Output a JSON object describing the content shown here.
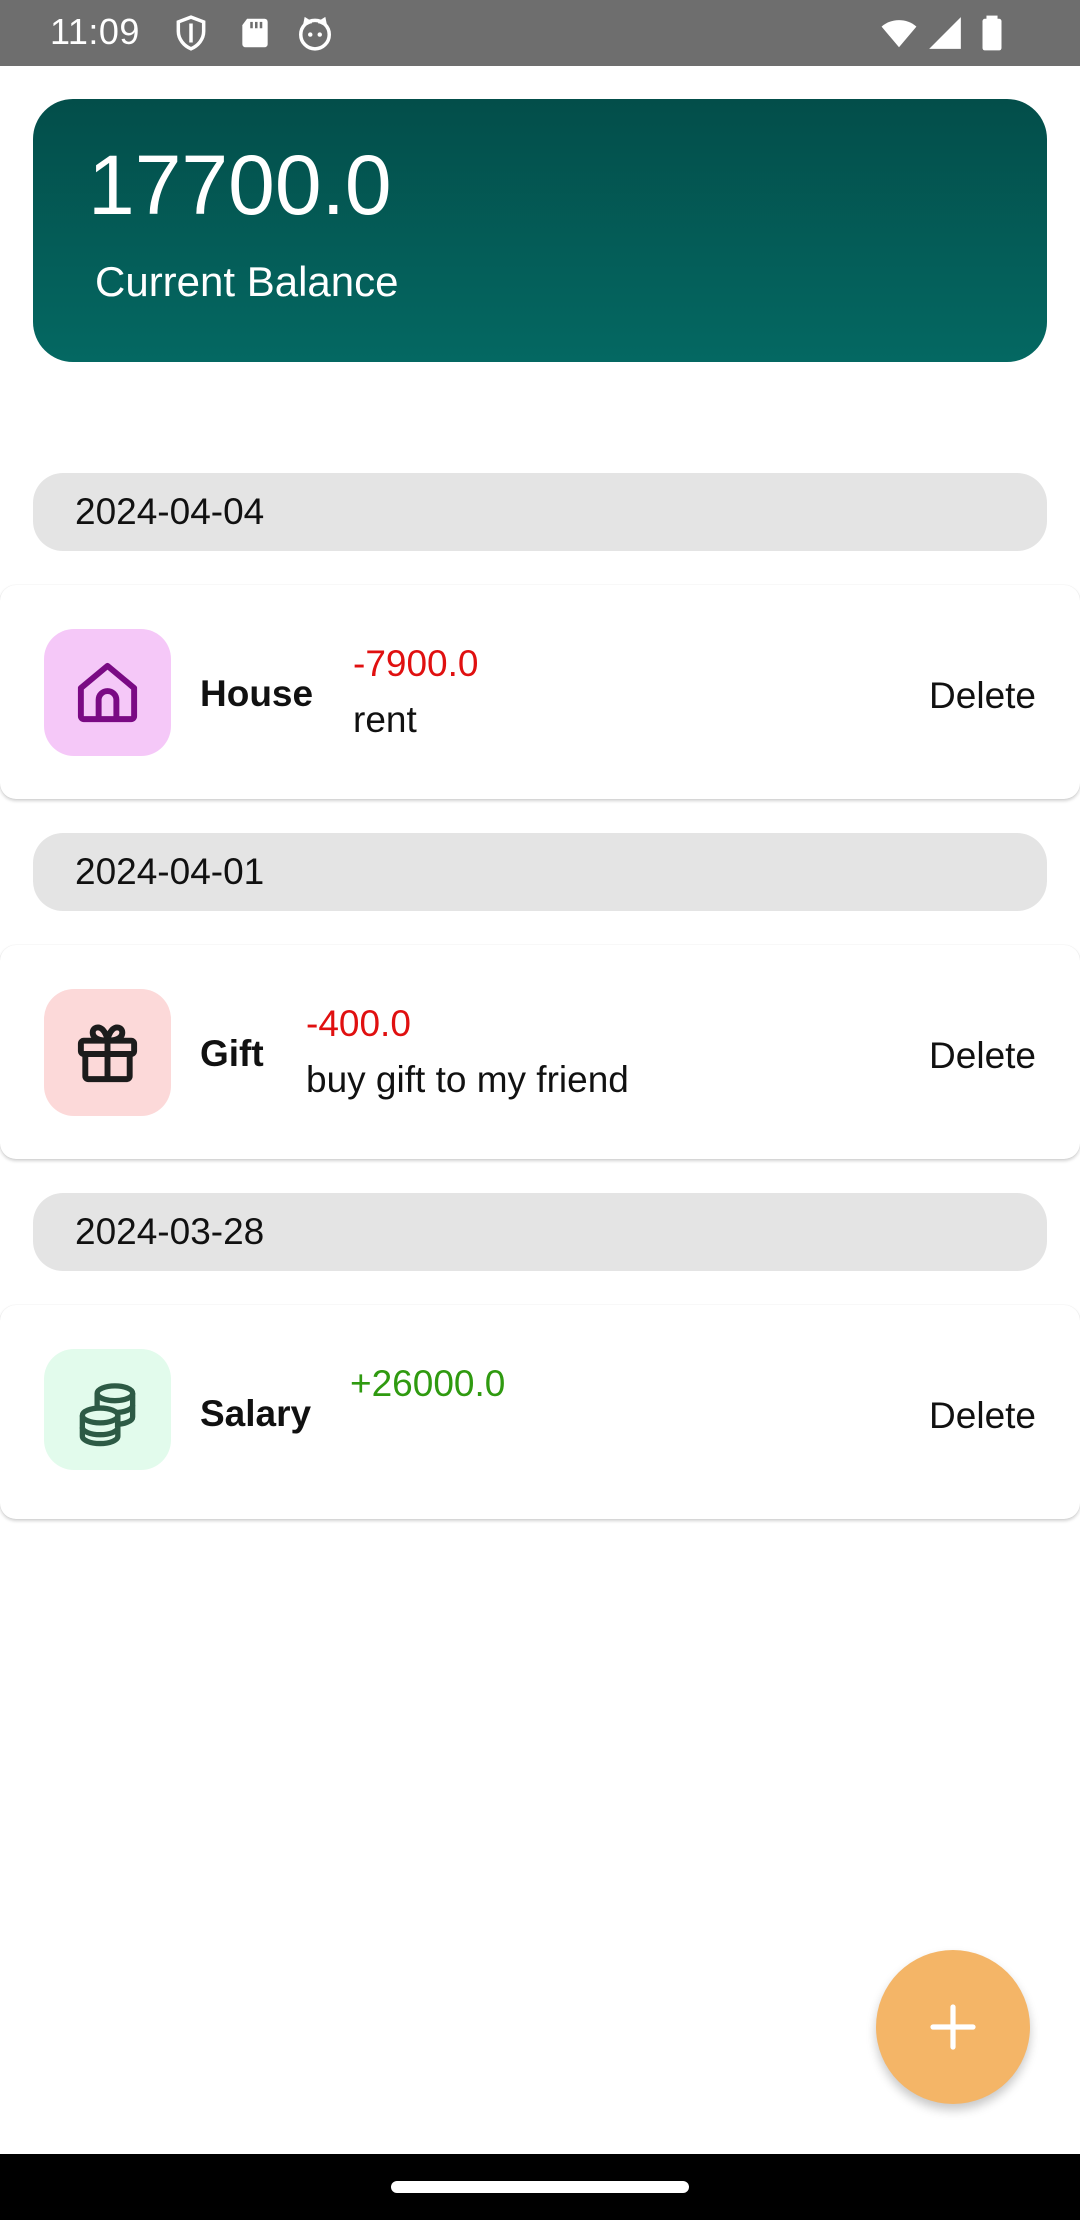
{
  "status_bar": {
    "time": "11:09",
    "left_icons": [
      "shield-icon",
      "sd-card-icon",
      "cat-face-icon"
    ],
    "right_icons": [
      "wifi-icon",
      "cell-signal-icon",
      "battery-icon"
    ]
  },
  "balance": {
    "amount": "17700.0",
    "label": "Current Balance"
  },
  "groups": [
    {
      "date": "2024-04-04",
      "transactions": [
        {
          "category": "House",
          "amount": "-7900.0",
          "note": "rent",
          "delete_label": "Delete",
          "icon": "house-icon",
          "icon_bg": "#f5c8f8",
          "icon_color": "#7a0a84",
          "amount_color": "#e01010"
        }
      ]
    },
    {
      "date": "2024-04-01",
      "transactions": [
        {
          "category": "Gift",
          "amount": "-400.0",
          "note": "buy gift to my friend",
          "delete_label": "Delete",
          "icon": "gift-icon",
          "icon_bg": "#fcd9d9",
          "icon_color": "#1c1c1c",
          "amount_color": "#e01010"
        }
      ]
    },
    {
      "date": "2024-03-28",
      "transactions": [
        {
          "category": "Salary",
          "amount": "+26000.0",
          "note": "",
          "delete_label": "Delete",
          "icon": "coins-icon",
          "icon_bg": "#e2fbec",
          "icon_color": "#2d5a45",
          "amount_color": "#2f9a10"
        }
      ]
    }
  ],
  "fab": {
    "icon": "plus-icon",
    "color": "#f4b567"
  }
}
